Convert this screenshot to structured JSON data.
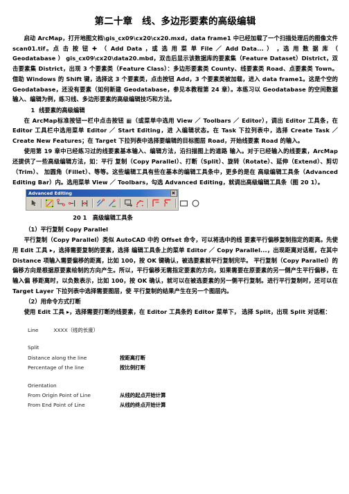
{
  "document": {
    "title": "第二十章　线、多边形要素的高级编辑",
    "paragraphs": [
      "启动 ArcMap，打开地图文档\\gis_cx09\\cx20\\cx20.mxd，data frame1 中已经加载了一个扫描处理后的图像文件 scan01.tif。点 击 按 钮 ✚ （ Add Data ，或 选 用 菜 单 File ／ Add Data... ） ，选 用 数 据 库 （ Geodatabase ） gis_cx09\\cx20\\data20.mbd，双击后显示该数据库的要素集（Feature Dataset）District，双击要素集 District，出现 3 个要素类（Feature Class）：多边形要素类 County、线要素类 Road、点要素类 Town。 借助 Windows 的 Shift 键，选择这 3 个要素类，点击按钮 Add，3 个要素类被加载，进入 data frame1。这是个空的 Geodatabase，还没有要素（如何新建 Geodatabase，参见本教程第 24 章）。本练习以 Geodatabase 的空间数据输入、编辑为例，练习线、多边形要素的高级编辑技巧和方法。"
    ],
    "section1": {
      "number": "1",
      "heading": "线要素的高级编辑",
      "paragraphs": [
        "在 ArcMap标准按钮一栏中点击按钮 ▦（或菜单中选用 View ／ Toolbars ／ Editor），调出 Editor 工具条，在 Editor 工具栏中选用菜单 Editor ／ Start Editing，进 入编辑状态。在 Task 下拉列表中，选择 Create Task ／ Create New Features；在 Target 下拉列表中选择要编辑的目标图层 Road，开始线要素 Road 的输入。",
        "使用第 19 章中已经练习过的线要素基本输入、编辑方法，沿扫描图上的道路 输入。对于已经输入的线要素，ArcMap 还提供了一些高级编辑方法，如：平行 复制（Copy Parallel）、打断（Split）、旋转（Rotate）、延伸（Extend）、剪切（Trim）、 加圆角（Fillet）、等等。这些编辑工具有些在基本的编辑工具条中，更多的是在 高级编辑工具条（Advanced Editing Bar）内。选用菜单 View ／ Toolbars，勾选 Advanced Editing，就调出高级编辑工具条（图 20 1）。"
      ]
    },
    "figure": {
      "toolbar_title": "Advanced Editing",
      "close_button": "close-icon",
      "caption": "20 1　高级编辑工具条",
      "buttons": [
        "select-arrow-icon",
        "copy-parallel-icon",
        "split-icon",
        "trim-icon",
        "extend-icon",
        "line-intersection-icon",
        "explode-icon",
        "generalize-icon",
        "smooth-icon",
        "fillet-left-icon",
        "fillet-right-icon",
        "rectangle-icon",
        "circle-icon"
      ]
    },
    "subsection1": {
      "heading": "（1）平行复制 Copy Parallel",
      "paragraphs": [
        "平行复制（Copy Parallel）类似 AutoCAD 中的 Offset 命令，可以将选中的线 要素平行偏移复制指定的距离。先使用 Edit 工具 ▸，选择需要复制的要素，选择 编辑工具条上的菜单 Editor ／ Copy Parallel...，出现距离对话框，在其中 Distance 项输入需要偏移的距离，比如 100，按 OK 键确认，被选要素就平行复制完毕。 平行复制（Copy Parallel）的偏移方向是根据原要素绘制的方向产生。所以，平行偏移无需指定要素的方向，如果需要在原要素的另一侧产生平行偏移，在输入偏 移距离时，以负数表示，比如 100，按 OK 确认，就可以在被选要素的另一侧平行复制。进行平行复制时，还可以在 Target Layer 下拉列表中选择需要图层，使 平行复制的结果产生在另一个图层内。"
      ]
    },
    "subsection2": {
      "heading": "（2）用命令方式打断",
      "paragraphs": [
        "使用 Edit 工具 ▸，选择需要打断的线要素，在 Editor 工具条的 Editor 菜单下， 选择 Split，出现 Split 对话框："
      ]
    },
    "split_dialog": {
      "rows": [
        {
          "label": "Line",
          "value": "XXXX（线的长度）",
          "type": "title"
        },
        {
          "label": "",
          "value": "",
          "type": "spacer"
        },
        {
          "label": "Split",
          "value": "",
          "type": "group"
        },
        {
          "label": "Distance along the line",
          "value": "按距离打断",
          "type": "item"
        },
        {
          "label": "Percentage of the line",
          "value": "按比例打断",
          "type": "item"
        },
        {
          "label": "",
          "value": "",
          "type": "spacer"
        },
        {
          "label": "Orientation",
          "value": "",
          "type": "group"
        },
        {
          "label": "From Origin Point of Line",
          "value": "从线的起点开始计算",
          "type": "item"
        },
        {
          "label": "From End Point of Line",
          "value": "从线的终点开始计算",
          "type": "item"
        }
      ]
    }
  }
}
